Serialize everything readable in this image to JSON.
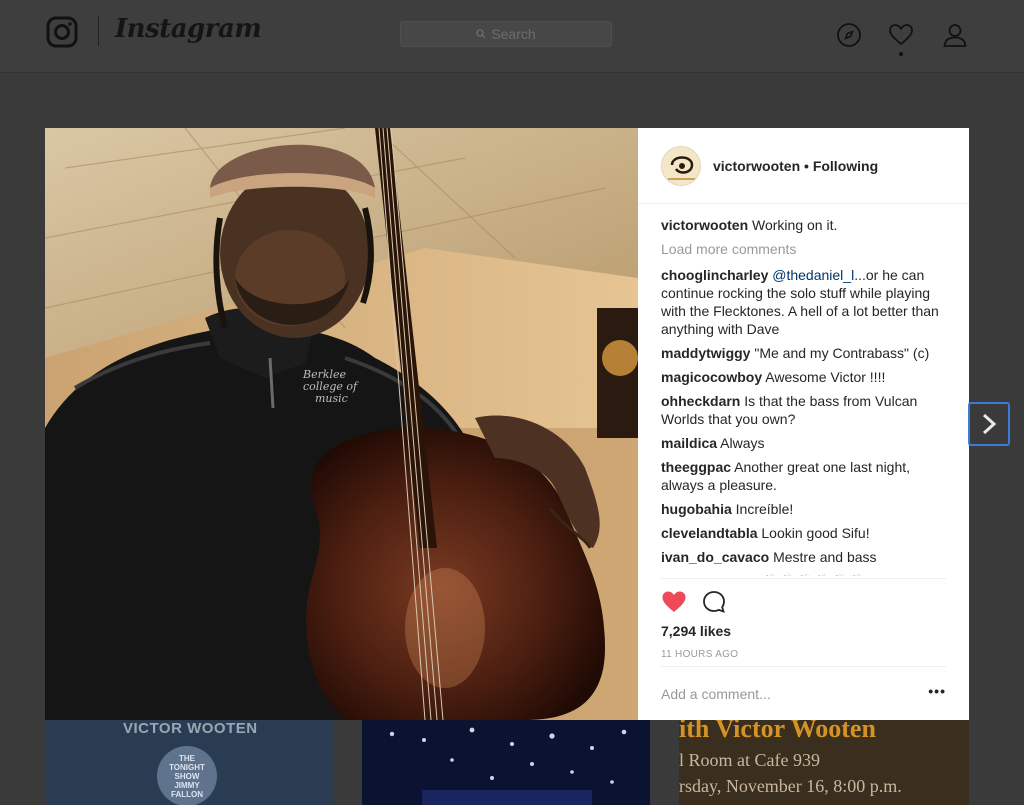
{
  "header": {
    "logo_text": "Instagram",
    "search_placeholder": "Search",
    "icons": [
      "instagram-camera-icon",
      "explore-compass-icon",
      "activity-heart-icon",
      "profile-user-icon"
    ]
  },
  "post": {
    "username": "victorwooten",
    "follow_status": "Following",
    "caption": {
      "user": "victorwooten",
      "text": "Working on it."
    },
    "load_more": "Load more comments",
    "comments": [
      {
        "user": "chooglincharley",
        "mention": "@thedaniel_l",
        "text": "...or he can continue rocking the solo stuff while playing with the Flecktones. A hell of a lot better than anything with Dave"
      },
      {
        "user": "maddytwiggy",
        "text": "\"Me and my Contrabass\" (c)"
      },
      {
        "user": "magicocowboy",
        "text": "Awesome Victor !!!!"
      },
      {
        "user": "ohheckdarn",
        "text": "Is that the bass from Vulcan Worlds that you own?"
      },
      {
        "user": "maildica",
        "text": "Always"
      },
      {
        "user": "theeggpac",
        "text": "Another great one last night, always a pleasure."
      },
      {
        "user": "hugobahia",
        "text": "Increíble!"
      },
      {
        "user": "clevelandtabla",
        "text": "Lookin good Sifu!"
      },
      {
        "user": "ivan_do_cavaco",
        "text": "Mestre and bass"
      },
      {
        "user": "eufelipemotaa",
        "text": "👏🏽👏🏽👏🏽👏🏽👏🏽👏🏽"
      }
    ],
    "likes": "7,294 likes",
    "time_ago": "11 HOURS AGO",
    "add_comment_placeholder": "Add a comment...",
    "more_options": "•••",
    "liked_color": "#ed4956"
  },
  "thumbnails": {
    "t1_title": "VICTOR WOOTEN",
    "t1_badge": "THE TONIGHT SHOW JIMMY FALLON",
    "t3_line1": "ith Victor Wooten",
    "t3_line2": "l Room at Cafe 939",
    "t3_line3": "rsday, November 16, 8:00 p.m."
  }
}
